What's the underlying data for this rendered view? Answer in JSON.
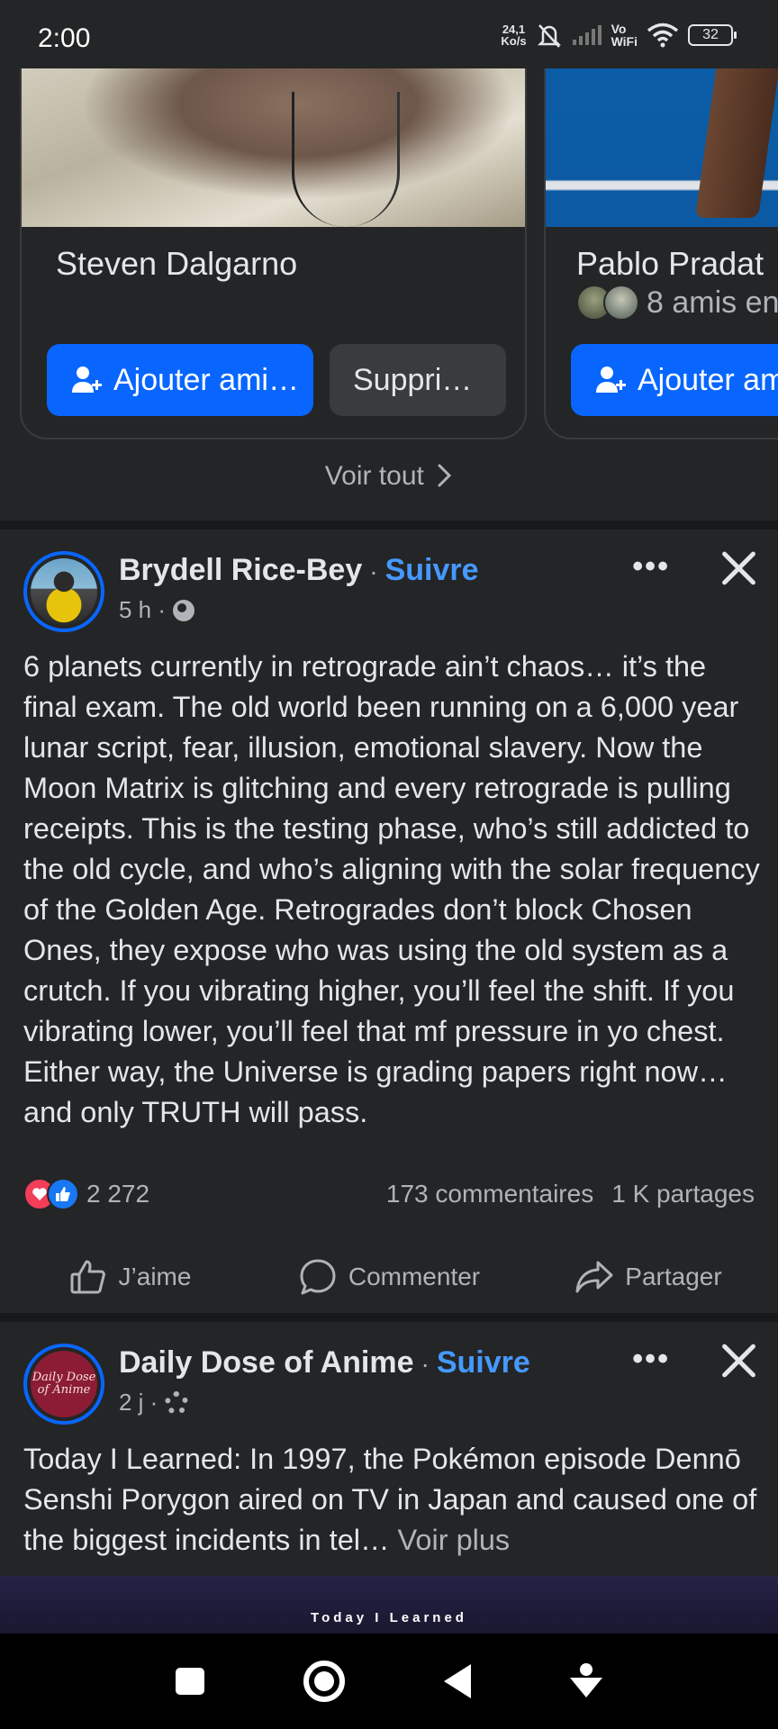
{
  "status_bar": {
    "time": "2:00",
    "speed_value": "24,1",
    "speed_unit": "Ko/s",
    "vowifi_top": "Vo",
    "vowifi_bottom": "WiFi",
    "battery": "32"
  },
  "suggestions": {
    "cards": [
      {
        "name": "Steven Dalgarno",
        "add_label": "Ajouter ami…",
        "remove_label": "Suppri…"
      },
      {
        "name": "Pablo Pradat",
        "mutual": "8 amis en",
        "add_label": "Ajouter am"
      }
    ],
    "see_all": "Voir tout"
  },
  "posts": [
    {
      "author": "Brydell Rice-Bey",
      "separator": "·",
      "follow": "Suivre",
      "time": "5 h ·",
      "more_icon": "more-horizontal-icon",
      "text": "6 planets currently in retrograde ain’t chaos… it’s the final exam. The old world been running on a 6,000 year lunar script, fear, illusion, emotional slavery. Now the Moon Matrix is glitching and every retrograde is pulling receipts. This is the testing phase, who’s still addicted to the old cycle, and who’s aligning with the solar frequency of the Golden Age. Retrogrades don’t block Chosen Ones, they expose who was using the old system as a crutch. If you vibrating higher, you’ll feel the shift. If you vibrating lower, you’ll feel that mf pressure in yo chest. Either way, the Universe is grading papers right now… and only TRUTH will pass.",
      "reaction_count": "2 272",
      "comments": "173 commentaires",
      "shares": "1 K partages"
    },
    {
      "author": "Daily Dose of Anime",
      "avatar_text": "Daily Dose of Anime",
      "separator": "·",
      "follow": "Suivre",
      "time": "2 j ·",
      "text": "Today I Learned: In 1997, the Pokémon episode Dennō Senshi Porygon aired on TV in Japan and caused one of the biggest incidents in tel…",
      "see_more": "Voir plus",
      "banner_text": "Today I Learned"
    }
  ],
  "actions": {
    "like": "J’aime",
    "comment": "Commenter",
    "share": "Partager"
  },
  "colors": {
    "background": "#242526",
    "divider": "#18191a",
    "accent": "#0866ff",
    "follow_link": "#4599ff",
    "secondary_text": "#b0b3b8"
  }
}
